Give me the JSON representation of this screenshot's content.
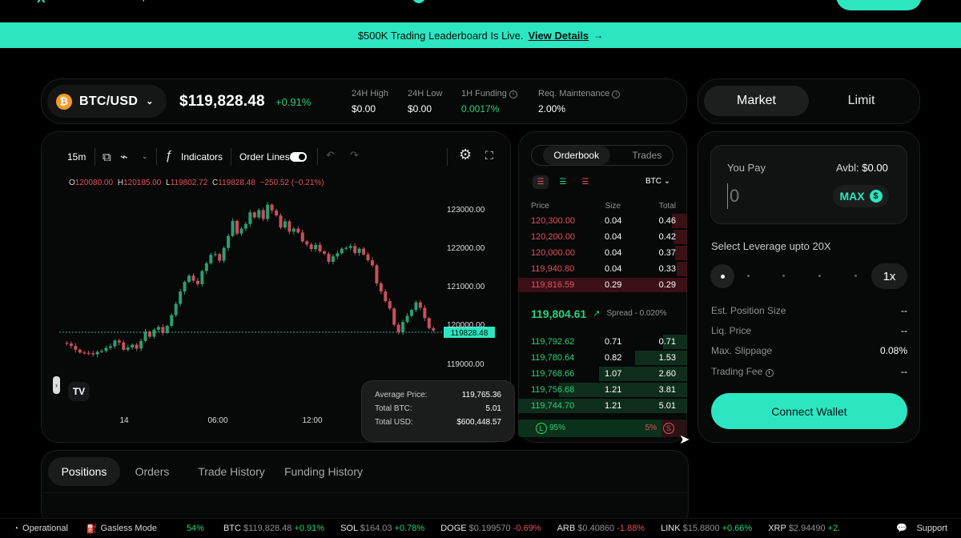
{
  "nav": {
    "logo": "X",
    "frags": [
      "p",
      "/",
      "/",
      "l"
    ]
  },
  "banner": {
    "text": "$500K Trading Leaderboard Is Live.",
    "link": "View Details",
    "arrow": "→"
  },
  "market": {
    "pair": "BTC/USD",
    "coin_icon": "₿",
    "price": "$119,828.48",
    "change": "+0.91%",
    "stats": [
      {
        "label": "24H High",
        "value": "$0.00"
      },
      {
        "label": "24H Low",
        "value": "$0.00"
      },
      {
        "label": "1H Funding",
        "value": "0.0017%"
      },
      {
        "label": "Req. Maintenance",
        "value": "2.00%"
      }
    ]
  },
  "chart_toolbar": {
    "interval": "15m",
    "indicators": "Indicators",
    "order_lines": "Order Lines"
  },
  "ohlc": {
    "o_label": "O",
    "o": "120080.00",
    "h_label": "H",
    "h": "120185.00",
    "l_label": "L",
    "l": "119802.72",
    "c_label": "C",
    "c": "119828.48",
    "change": "−250.52 (−0.21%)"
  },
  "chart_data": {
    "type": "candlestick",
    "y_ticks": [
      "123000.00",
      "122000.00",
      "121000.00",
      "120000.00",
      "119000.00"
    ],
    "x_ticks": [
      "14",
      "06:00",
      "12:00"
    ],
    "current_price": "119828.48",
    "ylim": [
      118800,
      123250
    ]
  },
  "tooltip": {
    "average_price_label": "Average Price:",
    "average_price": "119,765.36",
    "total_btc_label": "Total BTC:",
    "total_btc": "5.01",
    "total_usd_label": "Total USD:",
    "total_usd": "$600,448.57"
  },
  "orderbook": {
    "tab_active": "Orderbook",
    "tab_inactive": "Trades",
    "unit": "BTC",
    "headers": [
      "Price",
      "Size",
      "Total"
    ],
    "asks": [
      {
        "price": "120,300.00",
        "size": "0.04",
        "total": "0.46",
        "depth": 0.09
      },
      {
        "price": "120,200.00",
        "size": "0.04",
        "total": "0.42",
        "depth": 0.08
      },
      {
        "price": "120,000.00",
        "size": "0.04",
        "total": "0.37",
        "depth": 0.07
      },
      {
        "price": "119,940.80",
        "size": "0.04",
        "total": "0.33",
        "depth": 0.06
      },
      {
        "price": "119,816.59",
        "size": "0.29",
        "total": "0.29",
        "depth": 1.0
      }
    ],
    "mid_price": "119,804.61",
    "spread": "Spread - 0.020%",
    "bids": [
      {
        "price": "119,792.62",
        "size": "0.71",
        "total": "0.71",
        "depth": 0.14
      },
      {
        "price": "119,780.64",
        "size": "0.82",
        "total": "1.53",
        "depth": 0.31
      },
      {
        "price": "119,768.66",
        "size": "1.07",
        "total": "2.60",
        "depth": 0.52
      },
      {
        "price": "119,756.68",
        "size": "1.21",
        "total": "3.81",
        "depth": 0.76
      },
      {
        "price": "119,744.70",
        "size": "1.21",
        "total": "5.01",
        "depth": 1.0
      }
    ],
    "long_pct": "95%",
    "short_pct": "5%",
    "long_letter": "L",
    "short_letter": "S"
  },
  "order_form": {
    "market_tab": "Market",
    "limit_tab": "Limit",
    "you_pay": "You Pay",
    "avbl_label": "Avbl:",
    "avbl_value": "$0.00",
    "input_placeholder": "0",
    "max_label": "MAX",
    "leverage_label": "Select Leverage upto 20X",
    "leverage_value": "1x",
    "metrics": [
      {
        "label": "Est. Position Size",
        "value": "--"
      },
      {
        "label": "Liq. Price",
        "value": "--"
      },
      {
        "label": "Max. Slippage",
        "value": "0.08%"
      },
      {
        "label": "Trading Fee",
        "value": "--"
      }
    ],
    "connect": "Connect Wallet"
  },
  "bottom_tabs": [
    "Positions",
    "Orders",
    "Trade History",
    "Funding History"
  ],
  "footer": {
    "operational": "Operational",
    "gasless": "Gasless Mode",
    "lead_pct": "54%",
    "tickers": [
      {
        "symbol": "BTC",
        "price": "$119,828.48",
        "change": "+0.91%",
        "up": true
      },
      {
        "symbol": "SOL",
        "price": "$164.03",
        "change": "+0.78%",
        "up": true
      },
      {
        "symbol": "DOGE",
        "price": "$0.199570",
        "change": "-0.69%",
        "up": false
      },
      {
        "symbol": "ARB",
        "price": "$0.40860",
        "change": "-1.88%",
        "up": false
      },
      {
        "symbol": "LINK",
        "price": "$15.8800",
        "change": "+0.66%",
        "up": true
      },
      {
        "symbol": "XRP",
        "price": "$2.94490",
        "change": "+2.",
        "up": true
      }
    ],
    "support": "Support"
  },
  "colors": {
    "accent": "#2ce6c1",
    "green": "#29d17a",
    "red": "#e1525f",
    "background": "#000000"
  }
}
